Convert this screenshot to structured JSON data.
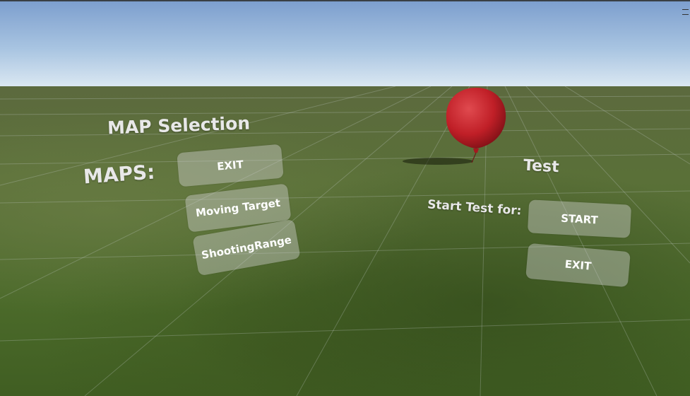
{
  "scene": {
    "colors": {
      "sky_top": "#7d9fce",
      "sky_horizon": "#dbe8f2",
      "grass": "#4b6a2a",
      "balloon": "#c8232c",
      "panel_button": "rgba(210,210,210,0.42)"
    }
  },
  "map_panel": {
    "title": "MAP Selection",
    "maps_label": "MAPS:",
    "buttons": {
      "exit": "EXIT",
      "moving_target": "Moving Target",
      "shooting_range": "ShootingRange"
    }
  },
  "test_panel": {
    "title": "Test",
    "start_label": "Start Test for:",
    "buttons": {
      "start": "START",
      "exit": "EXIT"
    }
  },
  "balloon": {
    "icon": "balloon-target"
  },
  "window": {
    "menu_icon": "menu-icon"
  }
}
